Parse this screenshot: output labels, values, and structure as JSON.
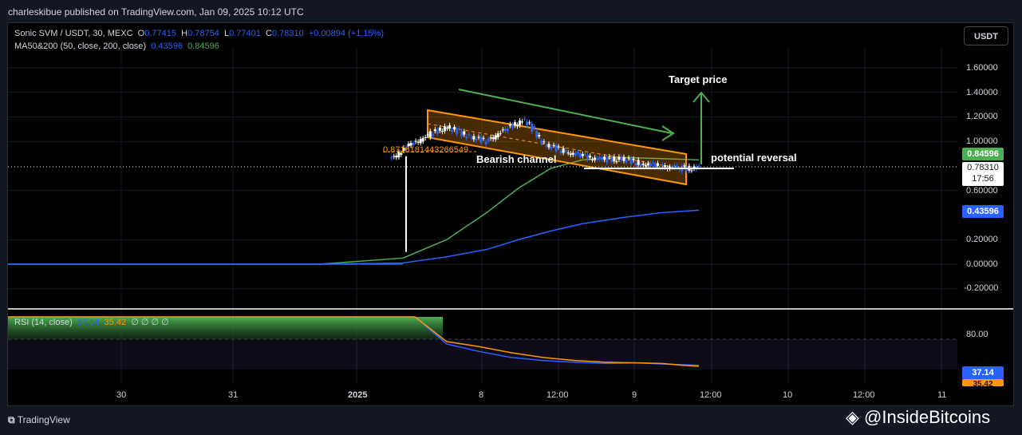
{
  "header": {
    "publish_line": "charleskibue published on TradingView.com, Jan 09, 2025 10:12 UTC"
  },
  "legend": {
    "symbol": "Sonic SVM / USDT, 30, MEXC",
    "o_label": "O",
    "o_value": "0.77415",
    "h_label": "H",
    "h_value": "0.78754",
    "l_label": "L",
    "l_value": "0.77401",
    "c_label": "C",
    "c_value": "0.78310",
    "change": "+0.00894 (+1.15%)",
    "ma_label": "MA50&200 (50, close, 200, close)",
    "ma50_value": "0.43596",
    "ma200_value": "0.84596",
    "rsi_label": "RSI (14, close)",
    "rsi_value": "37.14",
    "rsi_ma_value": "35.42",
    "rsi_extras": "∅ ∅ ∅ ∅"
  },
  "toolbar": {
    "currency": "USDT"
  },
  "price_axis": {
    "ticks": [
      "1.60000",
      "1.40000",
      "1.20000",
      "1.00000",
      "0.60000",
      "0.20000",
      "0.00000",
      "-0.20000"
    ],
    "badge_green": "0.84596",
    "badge_blue": "0.43596",
    "current_price": "0.78310",
    "countdown": "17:56"
  },
  "rsi_axis": {
    "tick": "80.00",
    "badge_blue": "37.14",
    "badge_orange": "35.42"
  },
  "time_axis": {
    "labels": [
      "30",
      "31",
      "2025",
      "8",
      "12:00",
      "9",
      "12:00",
      "10",
      "12:00",
      "11"
    ]
  },
  "annotations": {
    "target": "Target price",
    "channel": "Bearish channel",
    "reversal": "potential reversal",
    "level": "0.8716181443266549"
  },
  "colors": {
    "background": "#000000",
    "up": "#ffffff",
    "down": "#2962ff",
    "channel": "#ff9800",
    "ma_green": "#4caf50",
    "ma_blue": "#2962ff"
  },
  "footer": {
    "logo": "TradingView",
    "watermark": "@InsideBitcoins"
  },
  "chart_data": [
    {
      "type": "line",
      "title": "Sonic SVM / USDT, 30, MEXC",
      "ylim": [
        -0.3,
        1.7
      ],
      "series": [
        {
          "name": "MA50&200 (50, close, 200, close)",
          "values": [
            0.0,
            0.0,
            0.0,
            0.0,
            0.0,
            0.05,
            0.2,
            0.42,
            0.62,
            0.78,
            0.85,
            0.87,
            0.86,
            0.85
          ]
        },
        {
          "name": "MA50&200 (50, close, 200, close)",
          "values": [
            0.0,
            0.0,
            0.0,
            0.0,
            0.0,
            0.01,
            0.06,
            0.12,
            0.2,
            0.27,
            0.33,
            0.38,
            0.42,
            0.44
          ]
        },
        {
          "name": "Sonic SVM / USDT",
          "values": [
            0.96,
            1.05,
            1.12,
            1.05,
            1.0,
            1.1,
            1.18,
            0.98,
            0.92,
            0.88,
            0.85,
            0.86,
            0.82,
            0.8,
            0.78,
            0.783
          ]
        }
      ],
      "last_price": 0.7831
    },
    {
      "type": "line",
      "title": "RSI (14, close)",
      "ylim": [
        20,
        80
      ],
      "series": [
        {
          "name": "RSI (14, close)",
          "values": [
            80,
            80,
            80,
            80,
            72,
            60,
            50,
            45,
            42,
            40,
            41,
            39,
            38,
            37.14
          ]
        },
        {
          "name": "RSI (14, close)",
          "values": [
            80,
            80,
            80,
            80,
            76,
            68,
            58,
            50,
            45,
            42,
            41,
            40,
            37,
            35.42
          ]
        }
      ]
    }
  ]
}
